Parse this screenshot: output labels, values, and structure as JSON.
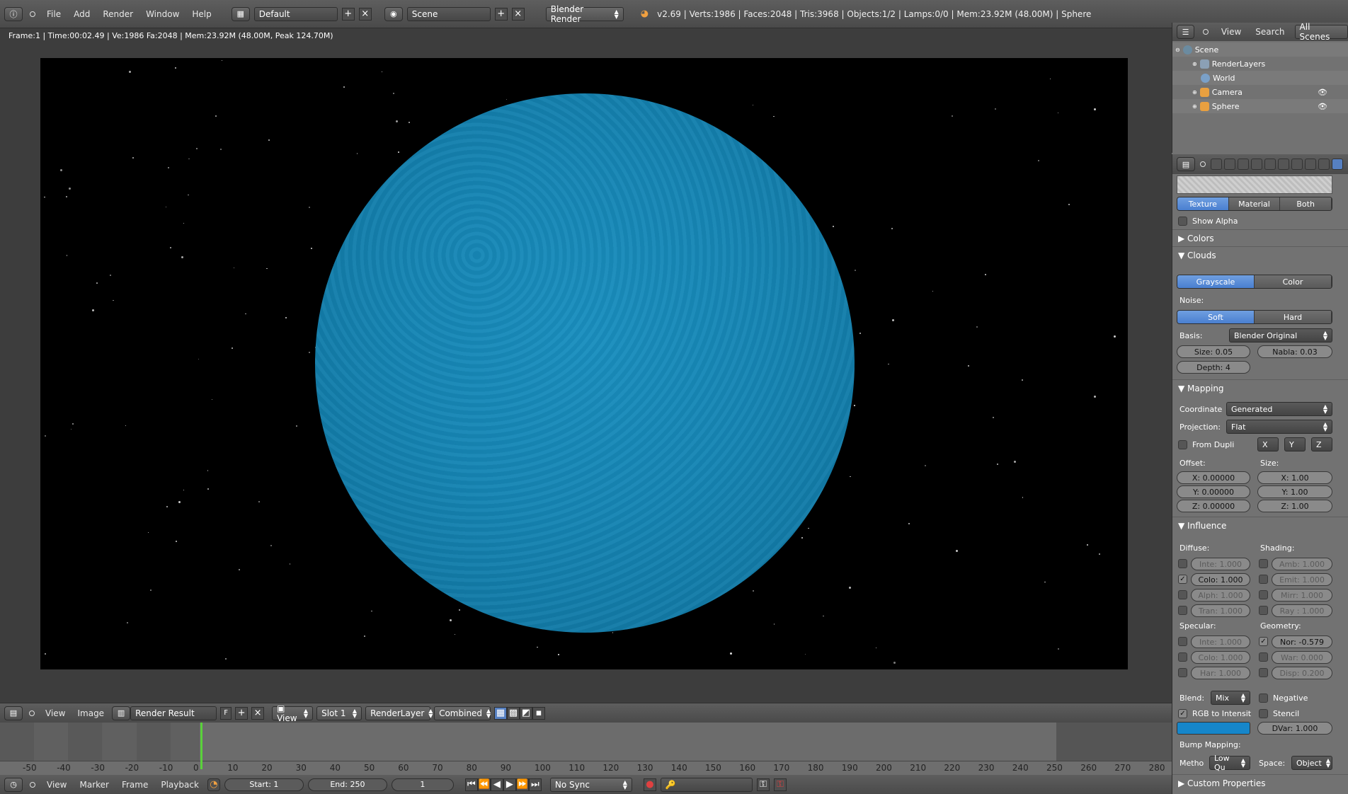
{
  "topbar": {
    "menus": [
      "File",
      "Add",
      "Render",
      "Window",
      "Help"
    ],
    "screen_layout": "Default",
    "scene": "Scene",
    "engine": "Blender Render",
    "stats": "v2.69 | Verts:1986 | Faces:2048 | Tris:3968 | Objects:1/2 | Lamps:0/0 | Mem:23.92M (48.00M) | Sphere"
  },
  "image_editor": {
    "info_line": "Frame:1 | Time:00:02.49 | Ve:1986 Fa:2048 | Mem:23.92M (48.00M, Peak 124.70M)",
    "header": {
      "view": "View",
      "image": "Image",
      "image_name": "Render Result",
      "fake_user": "F",
      "view_mode": "View",
      "slot": "Slot 1",
      "layer": "RenderLayer",
      "pass": "Combined"
    }
  },
  "timeline": {
    "ticks": [
      "-50",
      "-40",
      "-30",
      "-20",
      "-10",
      "0",
      "10",
      "20",
      "30",
      "40",
      "50",
      "60",
      "70",
      "80",
      "90",
      "100",
      "110",
      "120",
      "130",
      "140",
      "150",
      "160",
      "170",
      "180",
      "190",
      "200",
      "210",
      "220",
      "230",
      "240",
      "250",
      "260",
      "270",
      "280"
    ],
    "menus": [
      "View",
      "Marker",
      "Frame",
      "Playback"
    ],
    "start": "Start: 1",
    "end": "End: 250",
    "current": "1",
    "sync": "No Sync"
  },
  "outliner": {
    "header": {
      "view": "View",
      "search": "Search",
      "filter": "All Scenes"
    },
    "rows": [
      "Scene",
      "RenderLayers",
      "World",
      "Camera",
      "Sphere"
    ]
  },
  "properties": {
    "preview_tabs": [
      "Texture",
      "Material",
      "Both"
    ],
    "show_alpha": "Show Alpha",
    "colors_panel": "Colors",
    "clouds_panel": "Clouds",
    "clouds_mode": [
      "Grayscale",
      "Color"
    ],
    "noise_label": "Noise:",
    "noise_mode": [
      "Soft",
      "Hard"
    ],
    "basis_label": "Basis:",
    "basis_value": "Blender Original",
    "size": "Size: 0.05",
    "nabla": "Nabla: 0.03",
    "depth": "Depth: 4",
    "mapping_panel": "Mapping",
    "coordinate_label": "Coordinate",
    "coordinate_value": "Generated",
    "projection_label": "Projection:",
    "projection_value": "Flat",
    "from_dupli": "From Dupli",
    "axes": [
      "X",
      "Y",
      "Z"
    ],
    "offset_label": "Offset:",
    "size_label": "Size:",
    "offset": [
      "X: 0.00000",
      "Y: 0.00000",
      "Z: 0.00000"
    ],
    "size_xyz": [
      "X: 1.00",
      "Y: 1.00",
      "Z: 1.00"
    ],
    "influence_panel": "Influence",
    "diffuse_label": "Diffuse:",
    "shading_label": "Shading:",
    "diffuse": [
      "Inte: 1.000",
      "Colo: 1.000",
      "Alph: 1.000",
      "Tran: 1.000"
    ],
    "shading": [
      "Amb: 1.000",
      "Emit: 1.000",
      "Mirr: 1.000",
      "Ray : 1.000"
    ],
    "specular_label": "Specular:",
    "geometry_label": "Geometry:",
    "specular": [
      "Inte: 1.000",
      "Colo: 1.000",
      "Har: 1.000"
    ],
    "geometry": [
      "Nor: -0.579",
      "War: 0.000",
      "Disp: 0.200"
    ],
    "blend_label": "Blend:",
    "blend_value": "Mix",
    "negative": "Negative",
    "rgb_to_intensity": "RGB to Intensit",
    "stencil": "Stencil",
    "dvar": "DVar: 1.000",
    "bump_label": "Bump Mapping:",
    "method_label": "Metho",
    "method_value": "Low Qu",
    "space_label": "Space:",
    "space_value": "Object",
    "custom_props": "Custom Properties",
    "influence_color": "#1686ca"
  },
  "colors": {
    "accent": "#5680c2",
    "sphere": "#1686b5"
  }
}
